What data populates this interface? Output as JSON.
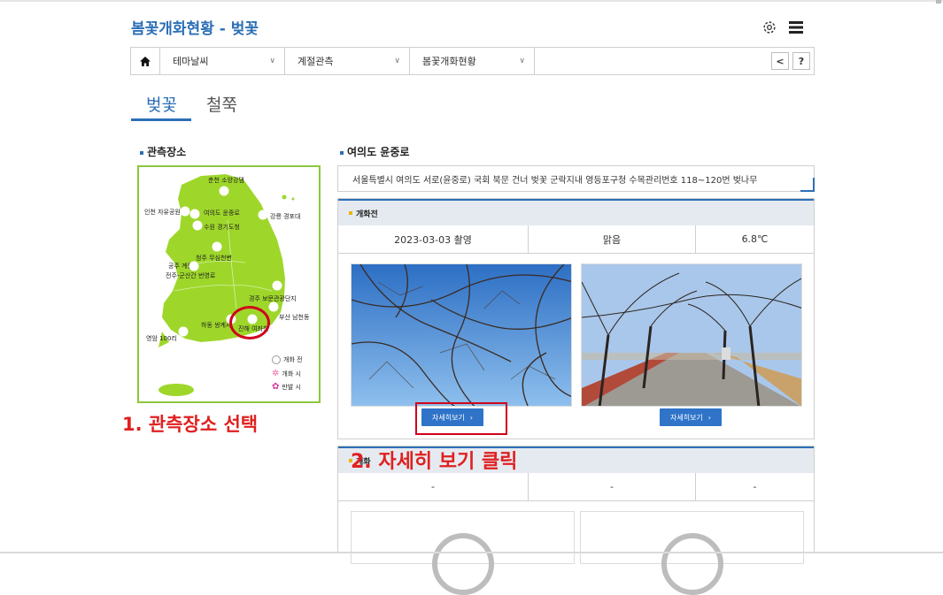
{
  "header": {
    "title": "봄꽃개화현황 - 벚꽃"
  },
  "nav": {
    "home_icon": "home-icon",
    "dropdowns": [
      {
        "label": "테마날씨"
      },
      {
        "label": "계절관측"
      },
      {
        "label": "봄꽃개화현황"
      }
    ],
    "share_glyph": "<",
    "help_glyph": "?"
  },
  "tabs": [
    {
      "label": "벚꽃",
      "active": true
    },
    {
      "label": "철쭉",
      "active": false
    }
  ],
  "map_section": {
    "title": "관측장소",
    "places": [
      "춘천 소양강댐",
      "인천 자유공원",
      "여의도 윤중로",
      "강릉 경포대",
      "수원 경기도청",
      "청주 무심천변",
      "공주 계룡산",
      "전주-군산간 번영로",
      "경주 보문관광단지",
      "부산 남천동",
      "하동 쌍계사",
      "진해 여좌천",
      "영암 100리"
    ],
    "legend": [
      "개화 전",
      "개화 시",
      "만발 시"
    ]
  },
  "detail_section": {
    "title": "여의도 윤중로",
    "address": "서울특별시 여의도 서로(윤중로) 국회 북문 건너 벚꽃 군락지내 영등포구청 수목관리번호 118~120번 벚나무"
  },
  "panel1": {
    "heading": "개화전",
    "date": "2023-03-03 촬영",
    "weather": "맑음",
    "temp": "6.8℃",
    "more_label": "자세히보기",
    "more_arrow": "›"
  },
  "panel2": {
    "heading": "개화",
    "date": "-",
    "weather": "-",
    "temp": "-"
  },
  "annotations": {
    "step1": "1. 관측장소 선택",
    "step2": "2. 자세히 보기 클릭"
  },
  "colors": {
    "brand_blue": "#2b6fb6",
    "map_green": "#9ed72a",
    "annotation_red": "#e02020"
  }
}
